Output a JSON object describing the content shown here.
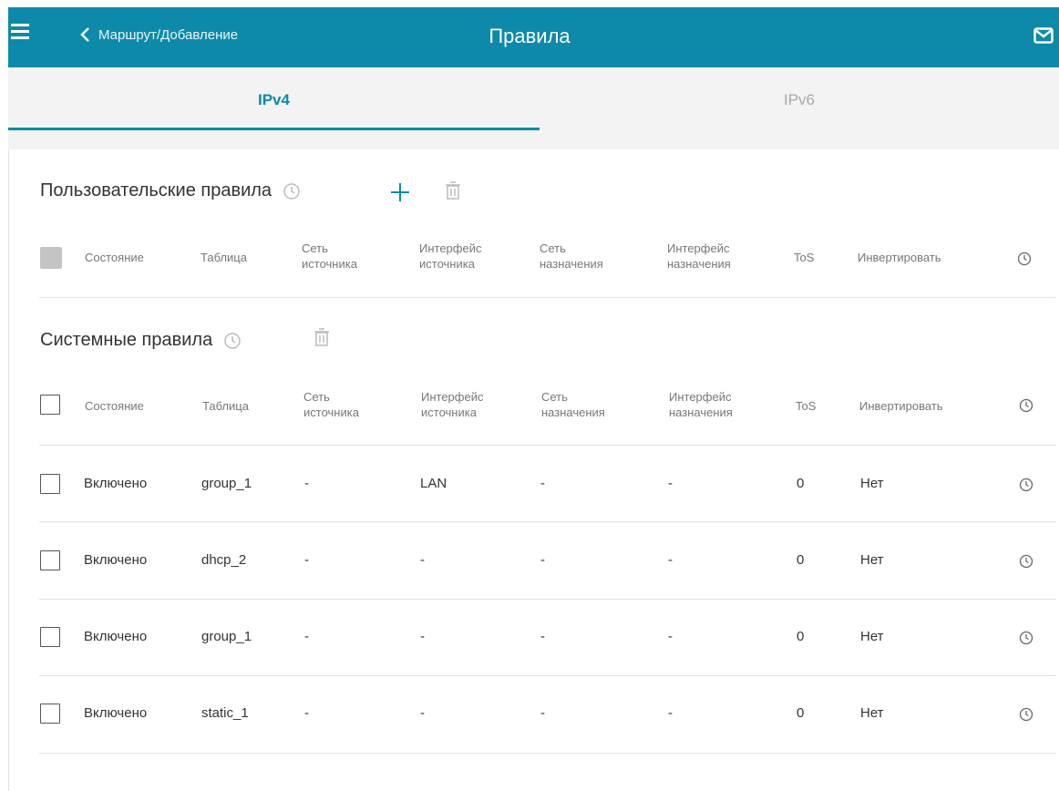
{
  "header": {
    "back_label": "Маршрут/Добавление",
    "title": "Правила",
    "accent_color": "#0d8aa9"
  },
  "tabs": [
    {
      "label": "IPv4",
      "active": true
    },
    {
      "label": "IPv6",
      "active": false
    }
  ],
  "user_rules": {
    "title": "Пользовательские правила",
    "columns": {
      "state": "Состояние",
      "table": "Таблица",
      "src_net_1": "Сеть",
      "src_net_2": "источника",
      "src_if_1": "Интерфейс",
      "src_if_2": "источника",
      "dst_net_1": "Сеть",
      "dst_net_2": "назначения",
      "dst_if_1": "Интерфейс",
      "dst_if_2": "назначения",
      "tos": "ToS",
      "invert": "Инвертировать"
    }
  },
  "system_rules": {
    "title": "Системные правила",
    "columns": {
      "state": "Состояние",
      "table": "Таблица",
      "src_net_1": "Сеть",
      "src_net_2": "источника",
      "src_if_1": "Интерфейс",
      "src_if_2": "источника",
      "dst_net_1": "Сеть",
      "dst_net_2": "назначения",
      "dst_if_1": "Интерфейс",
      "dst_if_2": "назначения",
      "tos": "ToS",
      "invert": "Инвертировать"
    },
    "rows": [
      {
        "state": "Включено",
        "table": "group_1",
        "src_net": "-",
        "src_if": "LAN",
        "dst_net": "-",
        "dst_if": "-",
        "tos": "0",
        "invert": "Нет"
      },
      {
        "state": "Включено",
        "table": "dhcp_2",
        "src_net": "-",
        "src_if": "-",
        "dst_net": "-",
        "dst_if": "-",
        "tos": "0",
        "invert": "Нет"
      },
      {
        "state": "Включено",
        "table": "group_1",
        "src_net": "-",
        "src_if": "-",
        "dst_net": "-",
        "dst_if": "-",
        "tos": "0",
        "invert": "Нет"
      },
      {
        "state": "Включено",
        "table": "static_1",
        "src_net": "-",
        "src_if": "-",
        "dst_net": "-",
        "dst_if": "-",
        "tos": "0",
        "invert": "Нет"
      }
    ]
  }
}
